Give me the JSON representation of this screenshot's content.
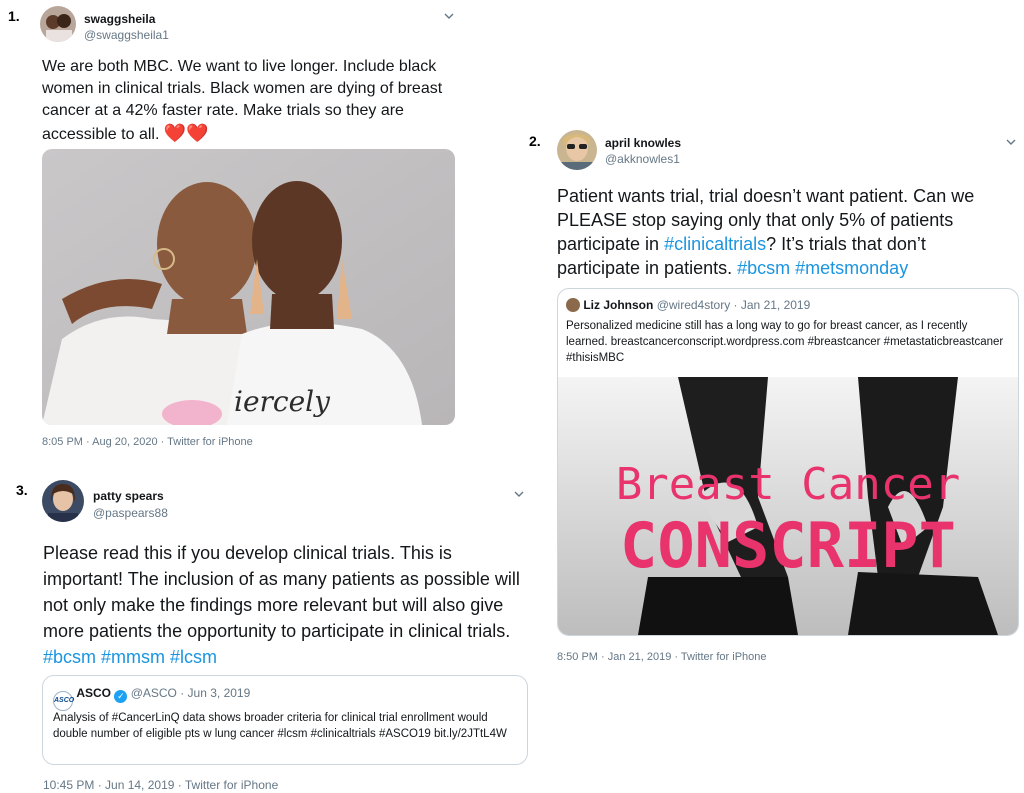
{
  "tweet1": {
    "number": "1.",
    "name": "swaggsheila",
    "handle": "@swaggsheila1",
    "text": "We are both MBC.  We want to live longer.  Include black women in clinical trials.  Black women are dying of breast cancer at a 42% faster rate.  Make trials so they are accessible to all.",
    "emoji": "❤️❤️",
    "meta": "8:05 PM · Aug 20, 2020 · Twitter for iPhone",
    "photo_shirt_text": "iercely"
  },
  "tweet2": {
    "number": "2.",
    "name": "april knowles",
    "handle": "@akknowles1",
    "text_plain": "Patient wants trial, trial doesn’t want patient. Can we PLEASE stop saying only that only 5% of patients participate in ",
    "tag1": "#clinicaltrials",
    "text_plain2": "? It’s trials that don’t participate in patients. ",
    "tag2": "#bcsm",
    "tag3": "#metsmonday",
    "quote": {
      "name": "Liz Johnson",
      "handle_date": "@wired4story · Jan 21, 2019",
      "text": "Personalized medicine still has a long way to go for breast cancer, as I recently learned. breastcancerconscript.wordpress.com #breastcancer #metastaticbreastcaner #thisisMBC",
      "image_line1": "Breast Cancer",
      "image_line2": "CONSCRIPT"
    },
    "meta": "8:50 PM · Jan 21, 2019 · Twitter for iPhone"
  },
  "tweet3": {
    "number": "3.",
    "name": "patty spears",
    "handle": "@paspears88",
    "text_plain": "Please read this if you develop clinical trials.  This is important!  The inclusion of as many patients as possible will not only make the findings more relevant but will also give more patients the opportunity to participate in clinical trials. ",
    "tag1": "#bcsm",
    "tag2": "#mmsm",
    "tag3": "#lcsm",
    "quote": {
      "logo": "ASCO",
      "name": "ASCO",
      "handle_date": "@ASCO · Jun 3, 2019",
      "text": "Analysis of #CancerLinQ data shows broader criteria for clinical trial enrollment would double number of eligible pts w lung cancer #lcsm #clinicaltrials #ASCO19 bit.ly/2JTtL4W"
    },
    "meta": "10:45 PM · Jun 14, 2019 · Twitter for iPhone"
  },
  "colors": {
    "link": "#1b95e0",
    "muted": "#657786",
    "border": "#ccd6dd",
    "heart": "#e0245e",
    "verified": "#1da1f2",
    "stamp": "#e8336d"
  }
}
